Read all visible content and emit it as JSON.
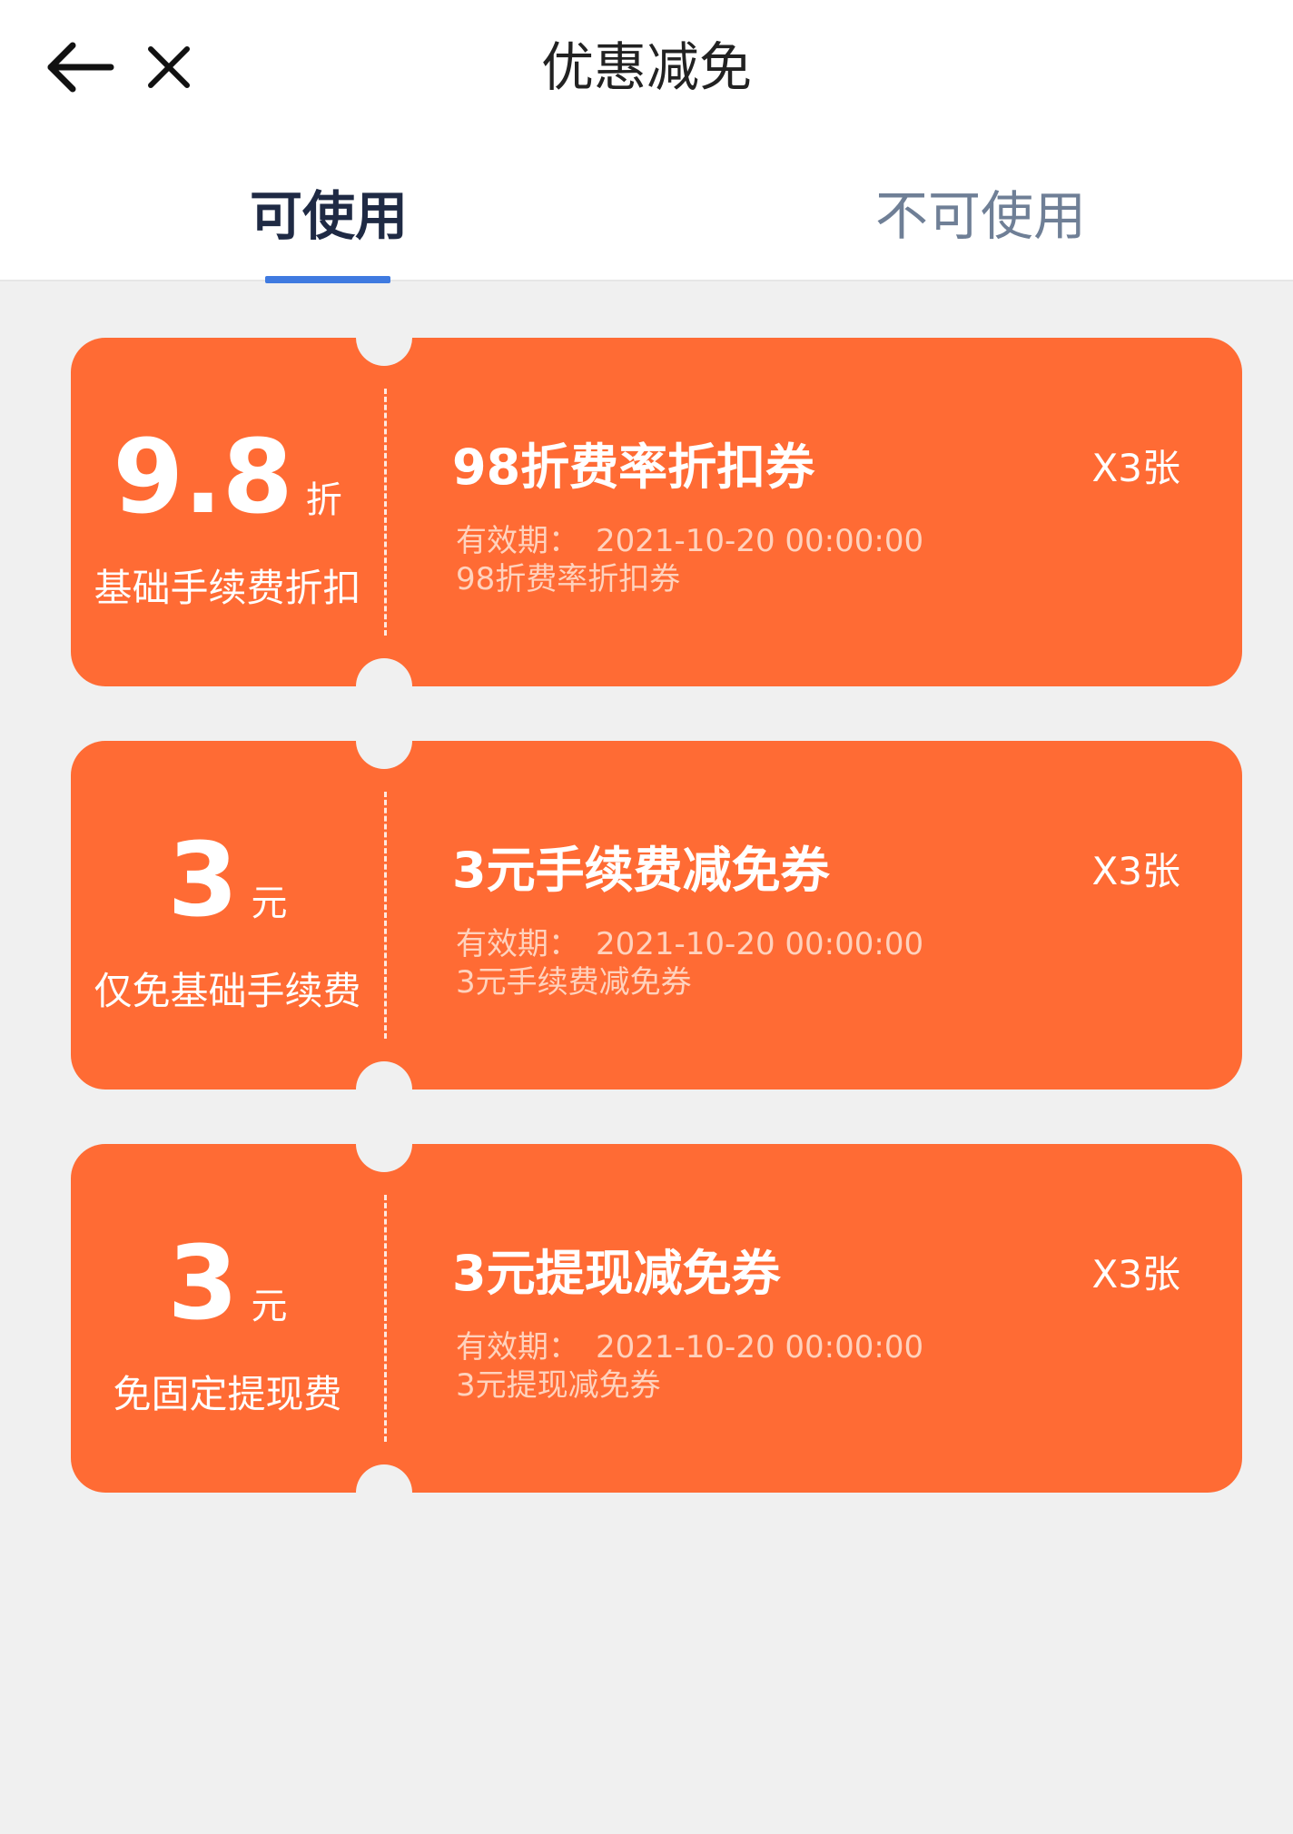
{
  "header": {
    "title": "优惠减免",
    "back_icon": "arrow-left-icon",
    "close_icon": "close-icon"
  },
  "tabs": [
    {
      "label": "可使用",
      "active": true
    },
    {
      "label": "不可使用",
      "active": false
    }
  ],
  "colors": {
    "coupon_bg": "#ff6b34",
    "page_bg": "#f0f0f0",
    "tab_indicator": "#3f7ae0",
    "active_tab_text": "#1f2a44",
    "inactive_tab_text": "#6f7f96"
  },
  "coupons": [
    {
      "amount": "9.8",
      "unit": "折",
      "subtitle": "基础手续费折扣",
      "title": "98折费率折扣券",
      "quantity": "X3张",
      "validity_label": "有效期：",
      "validity_date": "2021-10-20 00:00:00",
      "description": "98折费率折扣券"
    },
    {
      "amount": "3",
      "unit": "元",
      "subtitle": "仅免基础手续费",
      "title": "3元手续费减免券",
      "quantity": "X3张",
      "validity_label": "有效期：",
      "validity_date": "2021-10-20 00:00:00",
      "description": "3元手续费减免券"
    },
    {
      "amount": "3",
      "unit": "元",
      "subtitle": "免固定提现费",
      "title": "3元提现减免券",
      "quantity": "X3张",
      "validity_label": "有效期：",
      "validity_date": "2021-10-20 00:00:00",
      "description": "3元提现减免券"
    }
  ]
}
